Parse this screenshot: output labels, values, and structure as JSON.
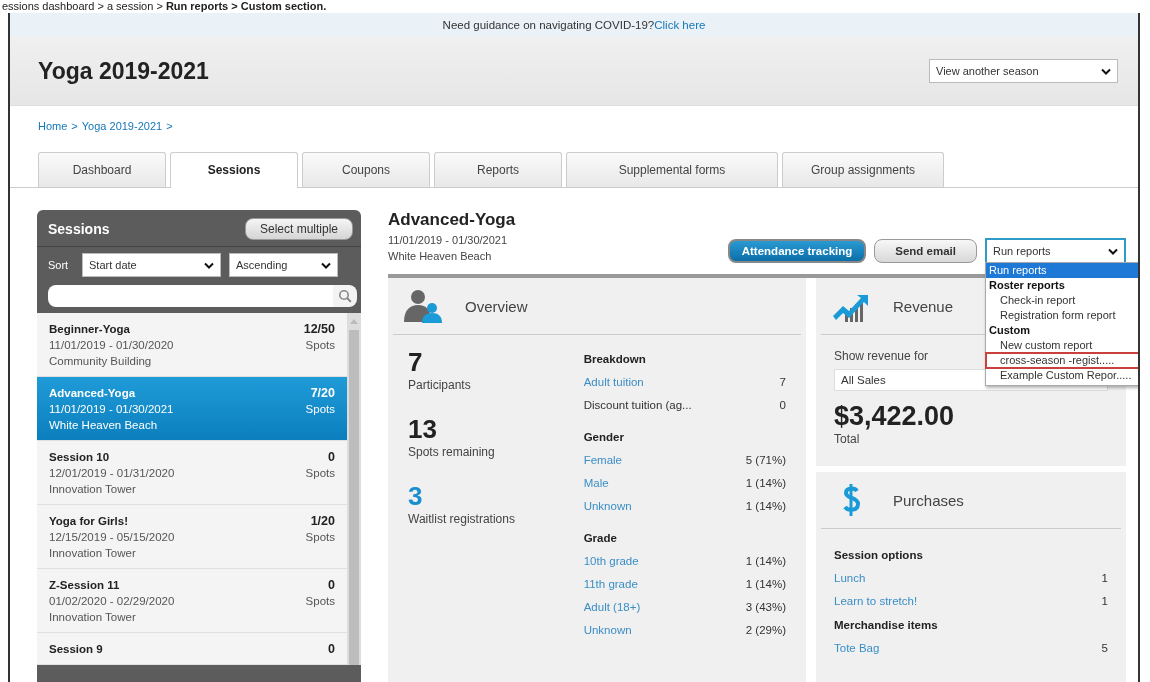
{
  "caption": "essions dashboard > a session > **Run reports > Custom section.**",
  "banner": {
    "text": "Need guidance on navigating COVID-19?",
    "link": "Click here"
  },
  "title": "Yoga 2019-2021",
  "season_select": "View another season",
  "breadcrumb": [
    {
      "label": "Home",
      "sep": ">"
    },
    {
      "label": "Yoga 2019-2021",
      "sep": ">"
    }
  ],
  "tabs": [
    {
      "label": "Dashboard",
      "selected": false
    },
    {
      "label": "Sessions",
      "selected": true
    },
    {
      "label": "Coupons",
      "selected": false
    },
    {
      "label": "Reports",
      "selected": false
    },
    {
      "label": "Supplemental forms",
      "selected": false
    },
    {
      "label": "Group assignments",
      "selected": false
    }
  ],
  "sidebar": {
    "title": "Sessions",
    "select_multiple": "Select multiple",
    "sort_label": "Sort",
    "sort_by": "Start date",
    "sort_order": "Ascending",
    "sessions": [
      {
        "name": "Beginner-Yoga",
        "dates": "11/01/2019 - 01/30/2020",
        "location": "Community Building",
        "count": "12/50",
        "unit": "Spots",
        "selected": false
      },
      {
        "name": "Advanced-Yoga",
        "dates": "11/01/2019 - 01/30/2021",
        "location": "White Heaven Beach",
        "count": "7/20",
        "unit": "Spots",
        "selected": true
      },
      {
        "name": "Session 10",
        "dates": "12/01/2019 - 01/31/2020",
        "location": "Innovation Tower",
        "count": "0",
        "unit": "Spots",
        "selected": false
      },
      {
        "name": "Yoga for Girls!",
        "dates": "12/15/2019 - 05/15/2020",
        "location": "Innovation Tower",
        "count": "1/20",
        "unit": "Spots",
        "selected": false
      },
      {
        "name": "Z-Session 11",
        "dates": "01/02/2020 - 02/29/2020",
        "location": "Innovation Tower",
        "count": "0",
        "unit": "Spots",
        "selected": false
      },
      {
        "name": "Session 9",
        "count": "0",
        "selected": false
      }
    ]
  },
  "session": {
    "name": "Advanced-Yoga",
    "dates": "11/01/2019 - 01/30/2021",
    "location": "White Heaven Beach"
  },
  "actions": [
    {
      "label": "Attendance tracking",
      "kind": "primary"
    },
    {
      "label": "Send email",
      "kind": "secondary"
    }
  ],
  "run_reports": {
    "value": "Run reports",
    "menu": [
      {
        "label": "Run reports",
        "kind": "highlighted",
        "outlined": false
      },
      {
        "label": "Roster reports",
        "kind": "group",
        "outlined": false
      },
      {
        "label": "Check-in report",
        "kind": "option",
        "outlined": false
      },
      {
        "label": "Registration form report",
        "kind": "option",
        "outlined": false
      },
      {
        "label": "Custom",
        "kind": "group",
        "outlined": false
      },
      {
        "label": "New custom report",
        "kind": "option",
        "outlined": false
      },
      {
        "label": "cross-season -regist.....",
        "kind": "option",
        "outlined": true
      },
      {
        "label": "Example Custom Repor.....",
        "kind": "option",
        "outlined": false
      }
    ]
  },
  "overview": {
    "title": "Overview",
    "stats": [
      {
        "value": "7",
        "label": "Participants",
        "kind": "plain"
      },
      {
        "value": "13",
        "label": "Spots remaining",
        "kind": "plain"
      },
      {
        "value": "3",
        "label": "Waitlist registrations",
        "kind": "link"
      }
    ],
    "sections": [
      {
        "heading": "Breakdown",
        "rows": [
          {
            "label": "Adult tuition",
            "value": "7",
            "link": true
          },
          {
            "label": "Discount tuition (ag...",
            "value": "0",
            "link": false
          }
        ]
      },
      {
        "heading": "Gender",
        "rows": [
          {
            "label": "Female",
            "value": "5 (71%)",
            "link": true
          },
          {
            "label": "Male",
            "value": "1 (14%)",
            "link": true
          },
          {
            "label": "Unknown",
            "value": "1 (14%)",
            "link": true
          }
        ]
      },
      {
        "heading": "Grade",
        "rows": [
          {
            "label": "10th grade",
            "value": "1 (14%)",
            "link": true
          },
          {
            "label": "11th grade",
            "value": "1 (14%)",
            "link": true
          },
          {
            "label": "Adult (18+)",
            "value": "3 (43%)",
            "link": true
          },
          {
            "label": "Unknown",
            "value": "2 (29%)",
            "link": true
          }
        ]
      }
    ]
  },
  "revenue": {
    "title": "Revenue",
    "show_label": "Show revenue for",
    "select": "All Sales",
    "amount": "$3,422.00",
    "total_label": "Total"
  },
  "purchases": {
    "title": "Purchases",
    "sections": [
      {
        "heading": "Session options",
        "rows": [
          {
            "label": "Lunch",
            "value": "1"
          },
          {
            "label": "Learn to stretch!",
            "value": "1"
          }
        ]
      },
      {
        "heading": "Merchandise items",
        "rows": [
          {
            "label": "Tote Bag",
            "value": "5"
          }
        ]
      }
    ]
  }
}
